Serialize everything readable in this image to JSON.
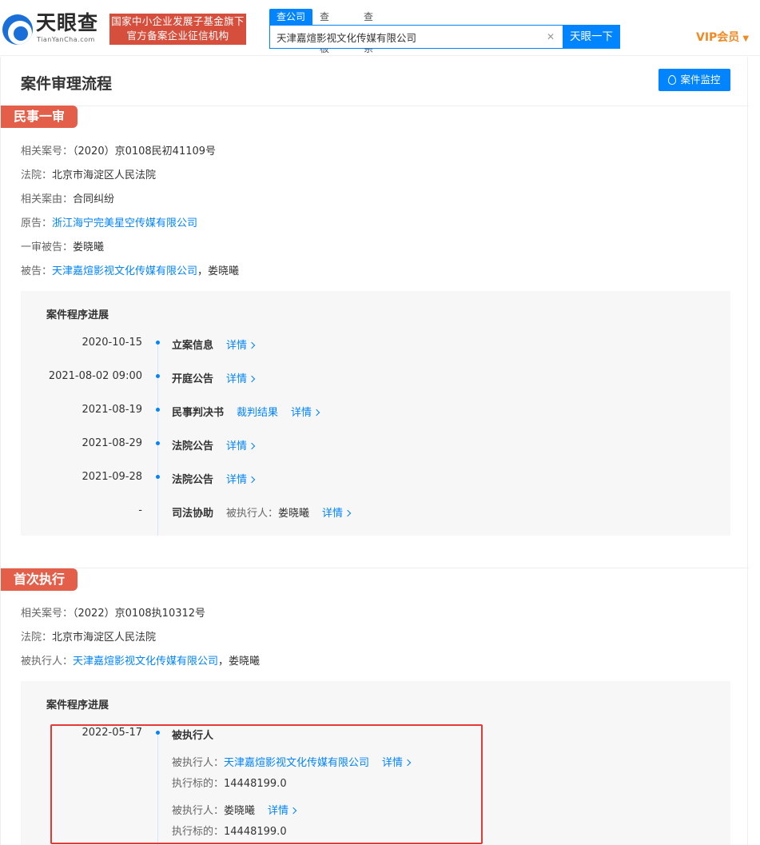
{
  "header": {
    "logo_text": "天眼查",
    "logo_sub": "TianYanCha.com",
    "gov_badge_line1": "国家中小企业发展子基金旗下",
    "gov_badge_line2": "官方备案企业征信机构",
    "search_tabs": [
      "查公司",
      "查老板",
      "查关系"
    ],
    "search_value": "天津嘉煊影视文化传媒有限公司",
    "search_button": "天眼一下",
    "vip_label": "VIP会员"
  },
  "page": {
    "title": "案件审理流程",
    "monitor_button": "案件监控"
  },
  "section1": {
    "tag": "民事一审",
    "case_no_label": "相关案号：",
    "case_no": "（2020）京0108民初41109号",
    "court_label": "法院：",
    "court": "北京市海淀区人民法院",
    "cause_label": "相关案由：",
    "cause": "合同纠纷",
    "plaintiff_label": "原告：",
    "plaintiff": "浙江海宁完美星空传媒有限公司",
    "first_defendant_label": "一审被告：",
    "first_defendant": "娄晓曦",
    "defendant_label": "被告：",
    "defendant_company": "天津嘉煊影视文化传媒有限公司",
    "defendant_sep": "，",
    "defendant_person": "娄晓曦",
    "progress_title": "案件程序进展",
    "timeline": [
      {
        "date": "2020-10-15",
        "event": "立案信息",
        "extra": "",
        "extra_person": "",
        "link": "详情"
      },
      {
        "date": "2021-08-02 09:00",
        "event": "开庭公告",
        "extra": "",
        "extra_person": "",
        "link": "详情"
      },
      {
        "date": "2021-08-19",
        "event": "民事判决书",
        "extra": "裁判结果",
        "extra_person": "",
        "link": "详情"
      },
      {
        "date": "2021-08-29",
        "event": "法院公告",
        "extra": "",
        "extra_person": "",
        "link": "详情"
      },
      {
        "date": "2021-09-28",
        "event": "法院公告",
        "extra": "",
        "extra_person": "",
        "link": "详情"
      },
      {
        "date": "-",
        "event": "司法协助",
        "extra": "被执行人：",
        "extra_person": "娄晓曦",
        "link": "详情"
      }
    ]
  },
  "section2": {
    "tag": "首次执行",
    "case_no_label": "相关案号：",
    "case_no": "（2022）京0108执10312号",
    "court_label": "法院：",
    "court": "北京市海淀区人民法院",
    "executed_label": "被执行人：",
    "executed_company": "天津嘉煊影视文化传媒有限公司",
    "executed_sep": "，",
    "executed_person": "娄晓曦",
    "progress_title": "案件程序进展",
    "timeline_date": "2022-05-17",
    "timeline_event": "被执行人",
    "entries": [
      {
        "executed_label": "被执行人：",
        "executed": "天津嘉煊影视文化传媒有限公司",
        "link": "详情",
        "target_label": "执行标的：",
        "target": "14448199.0"
      },
      {
        "executed_label": "被执行人：",
        "executed": "娄晓曦",
        "link": "详情",
        "target_label": "执行标的：",
        "target": "14448199.0"
      }
    ]
  }
}
